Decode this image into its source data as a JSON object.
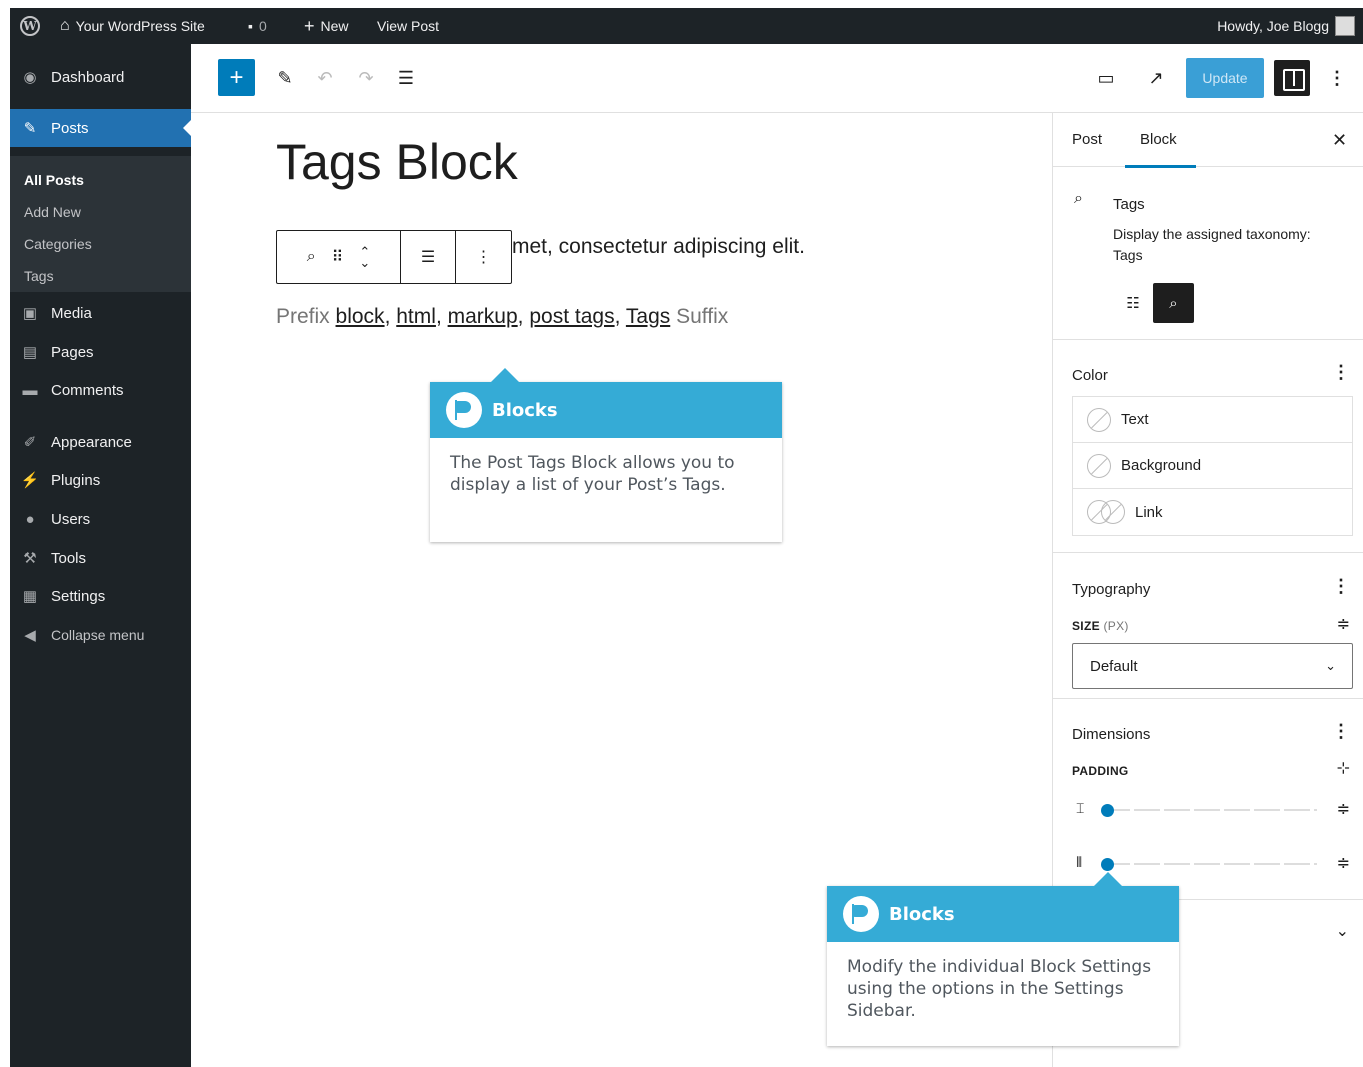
{
  "admin_bar": {
    "site_name": "Your WordPress Site",
    "comment_count": "0",
    "new_label": "New",
    "view_post_label": "View Post",
    "howdy": "Howdy, Joe Blogg"
  },
  "admin_menu": {
    "dashboard": "Dashboard",
    "posts": "Posts",
    "posts_sub": [
      "All Posts",
      "Add New",
      "Categories",
      "Tags"
    ],
    "media": "Media",
    "pages": "Pages",
    "comments": "Comments",
    "appearance": "Appearance",
    "plugins": "Plugins",
    "users": "Users",
    "tools": "Tools",
    "settings": "Settings",
    "collapse": "Collapse menu"
  },
  "editor_toolbar": {
    "add_icon": "plus-icon",
    "update_label": "Update"
  },
  "canvas": {
    "title": "Tags Block",
    "paragraph_visible": "met, consectetur adipiscing elit.",
    "prefix": "Prefix",
    "tags": [
      "block",
      "html",
      "markup",
      "post tags",
      "Tags"
    ],
    "suffix": "Suffix"
  },
  "callouts": [
    {
      "title": "Blocks",
      "text": "The Post Tags Block allows you to display a list of your Post’s Tags."
    },
    {
      "title": "Blocks",
      "text": "Modify the individual Block Settings using the options in the Settings Sidebar."
    }
  ],
  "settings_sidebar": {
    "tabs": [
      "Post",
      "Block"
    ],
    "active_tab": "Block",
    "block_name": "Tags",
    "block_description": "Display the assigned taxonomy: Tags",
    "color": {
      "title": "Color",
      "items": [
        "Text",
        "Background",
        "Link"
      ]
    },
    "typography": {
      "title": "Typography",
      "size_label": "SIZE",
      "size_unit": "(PX)",
      "size_value": "Default"
    },
    "dimensions": {
      "title": "Dimensions",
      "padding_label": "PADDING",
      "vertical_padding": 0,
      "horizontal_padding": 0
    }
  },
  "colors": {
    "admin_dark": "#1d2327",
    "accent_blue": "#007cba",
    "callout_blue": "#35abd6"
  }
}
